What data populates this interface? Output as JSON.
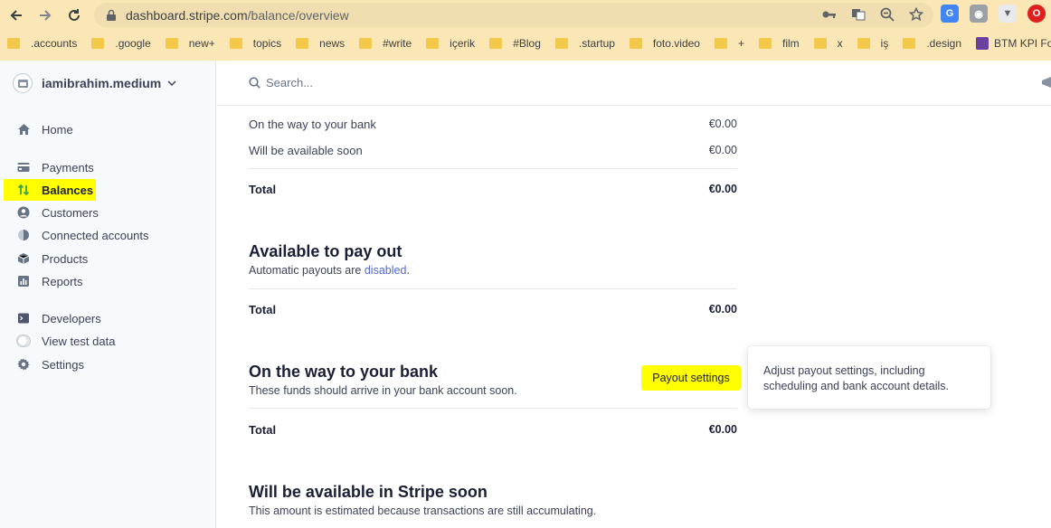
{
  "browser": {
    "url_host": "dashboard.stripe.com",
    "url_path": "/balance/overview",
    "bookmarks": [
      {
        "label": ".accounts"
      },
      {
        "label": ".google"
      },
      {
        "label": "new+"
      },
      {
        "label": "topics"
      },
      {
        "label": "news"
      },
      {
        "label": "#write"
      },
      {
        "label": "içerik"
      },
      {
        "label": "#Blog"
      },
      {
        "label": ".startup"
      },
      {
        "label": "foto.video"
      },
      {
        "label": "+"
      },
      {
        "label": "film"
      },
      {
        "label": "x"
      },
      {
        "label": "iş"
      },
      {
        "label": ".design"
      },
      {
        "label": "BTM KPI Formu"
      }
    ]
  },
  "sidebar": {
    "account_name": "iamibrahim.medium",
    "items": [
      {
        "label": "Home"
      },
      {
        "label": "Payments"
      },
      {
        "label": "Balances"
      },
      {
        "label": "Customers"
      },
      {
        "label": "Connected accounts"
      },
      {
        "label": "Products"
      },
      {
        "label": "Reports"
      },
      {
        "label": "Developers"
      },
      {
        "label": "View test data"
      },
      {
        "label": "Settings"
      }
    ]
  },
  "search": {
    "placeholder": "Search..."
  },
  "summary": {
    "rows": [
      {
        "label": "On the way to your bank",
        "amount": "€0.00"
      },
      {
        "label": "Will be available soon",
        "amount": "€0.00"
      }
    ],
    "total_label": "Total",
    "total_amount": "€0.00"
  },
  "available": {
    "title": "Available to pay out",
    "subtitle_prefix": "Automatic payouts are ",
    "subtitle_link": "disabled",
    "subtitle_suffix": ".",
    "total_label": "Total",
    "total_amount": "€0.00"
  },
  "on_the_way": {
    "title": "On the way to your bank",
    "subtitle": "These funds should arrive in your bank account soon.",
    "button": "Payout settings",
    "tooltip": "Adjust payout settings, including scheduling and bank account details.",
    "total_label": "Total",
    "total_amount": "€0.00"
  },
  "stripe_soon": {
    "title": "Will be available in Stripe soon",
    "subtitle": "This amount is estimated because transactions are still accumulating."
  },
  "colors": {
    "highlight": "#ffff00",
    "link": "#5469d4",
    "chrome": "#fbe7b5"
  }
}
